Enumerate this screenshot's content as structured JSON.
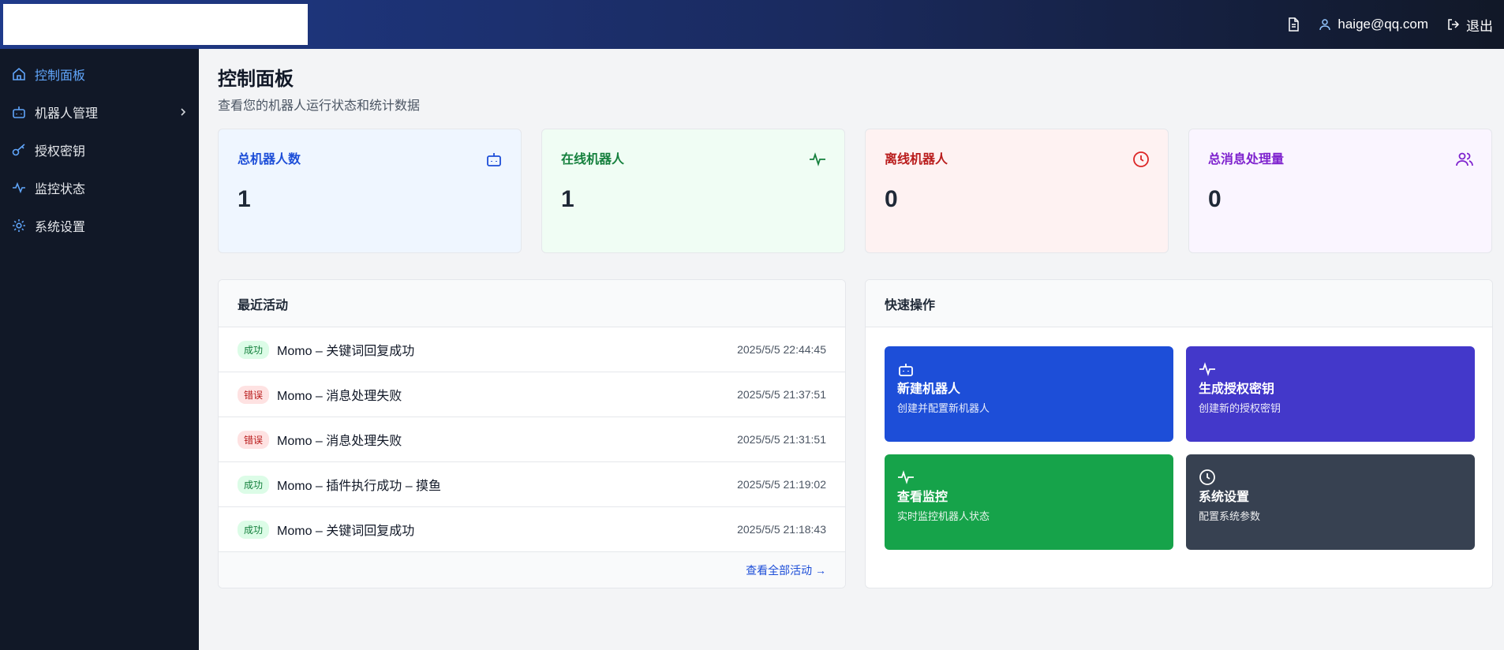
{
  "header": {
    "user_email": "haige@qq.com",
    "logout_label": "退出"
  },
  "sidebar": {
    "items": [
      {
        "label": "控制面板",
        "icon": "home-icon",
        "active": true
      },
      {
        "label": "机器人管理",
        "icon": "bot-icon"
      },
      {
        "label": "授权密钥",
        "icon": "key-icon"
      },
      {
        "label": "监控状态",
        "icon": "activity-icon"
      },
      {
        "label": "系统设置",
        "icon": "gear-icon"
      }
    ]
  },
  "page": {
    "title": "控制面板",
    "subtitle": "查看您的机器人运行状态和统计数据"
  },
  "stats": [
    {
      "label": "总机器人数",
      "value": "1",
      "icon": "bot-icon",
      "color": "#1d4ed8"
    },
    {
      "label": "在线机器人",
      "value": "1",
      "icon": "activity-icon",
      "color": "#15803d"
    },
    {
      "label": "离线机器人",
      "value": "0",
      "icon": "clock-icon",
      "color": "#dc2626"
    },
    {
      "label": "总消息处理量",
      "value": "0",
      "icon": "users-icon",
      "color": "#7e22ce"
    }
  ],
  "activity": {
    "title": "最近活动",
    "rows": [
      {
        "status": "成功",
        "text": "Momo – 关键词回复成功",
        "time": "2025/5/5 22:44:45"
      },
      {
        "status": "错误",
        "text": "Momo – 消息处理失败",
        "time": "2025/5/5 21:37:51"
      },
      {
        "status": "错误",
        "text": "Momo – 消息处理失败",
        "time": "2025/5/5 21:31:51"
      },
      {
        "status": "成功",
        "text": "Momo – 插件执行成功 – 摸鱼",
        "time": "2025/5/5 21:19:02"
      },
      {
        "status": "成功",
        "text": "Momo – 关键词回复成功",
        "time": "2025/5/5 21:18:43"
      }
    ],
    "view_all": "查看全部活动 →"
  },
  "quick": {
    "title": "快速操作",
    "cards": [
      {
        "title": "新建机器人",
        "desc": "创建并配置新机器人",
        "icon": "bot-icon",
        "color": "#1d4ed8"
      },
      {
        "title": "生成授权密钥",
        "desc": "创建新的授权密钥",
        "icon": "activity-icon",
        "color": "#4338ca"
      },
      {
        "title": "查看监控",
        "desc": "实时监控机器人状态",
        "icon": "activity-icon",
        "color": "#16a34a"
      },
      {
        "title": "系统设置",
        "desc": "配置系统参数",
        "icon": "clock-icon",
        "color": "#374151"
      }
    ]
  }
}
